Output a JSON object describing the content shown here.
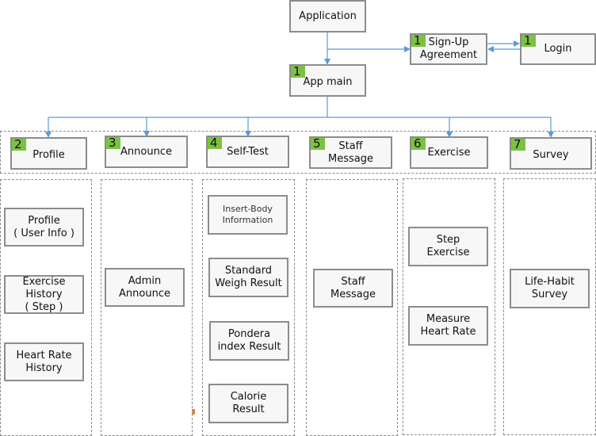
{
  "colors": {
    "connector": "#5b9bd5",
    "badge": "#7cc242",
    "box_fill": "#f7f7f7",
    "box_border": "#8c8c8c",
    "group_border": "#8a8a8a"
  },
  "top": {
    "application": {
      "label": "Application"
    },
    "signup": {
      "badge": "1",
      "label": "Sign-Up\nAgreement"
    },
    "login": {
      "badge": "1",
      "label": "Login"
    },
    "app_main": {
      "badge": "1",
      "label": "App main"
    }
  },
  "menu": [
    {
      "badge": "2",
      "label": "Profile"
    },
    {
      "badge": "3",
      "label": "Announce"
    },
    {
      "badge": "4",
      "label": "Self-Test"
    },
    {
      "badge": "5",
      "label": "Staff\nMessage"
    },
    {
      "badge": "6",
      "label": "Exercise"
    },
    {
      "badge": "7",
      "label": "Survey"
    }
  ],
  "columns": [
    {
      "items": [
        "Profile\n( User Info )",
        "Exercise\nHistory\n( Step )",
        "Heart Rate\nHistory"
      ]
    },
    {
      "items": [
        "Admin\nAnnounce"
      ]
    },
    {
      "items": [
        "Insert-Body\nInformation",
        "Standard\nWeigh Result",
        "Pondera\nindex Result",
        "Calorie\nResult"
      ]
    },
    {
      "items": [
        "Staff\nMessage"
      ]
    },
    {
      "items": [
        "Step\nExercise",
        "Measure\nHeart Rate"
      ]
    },
    {
      "items": [
        "Life-Habit\nSurvey"
      ]
    }
  ]
}
